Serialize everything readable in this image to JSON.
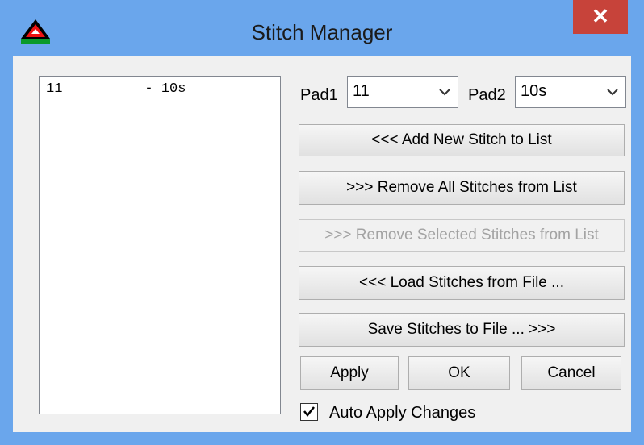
{
  "window": {
    "title": "Stitch Manager",
    "close_label": "✕"
  },
  "stitch_list": {
    "items": [
      "11          - 10s"
    ]
  },
  "pad1": {
    "label": "Pad1",
    "value": "11"
  },
  "pad2": {
    "label": "Pad2",
    "value": "10s"
  },
  "buttons": {
    "add": "<<< Add New Stitch to List",
    "remove_all": ">>> Remove All Stitches from List",
    "remove_selected": ">>> Remove Selected Stitches from List",
    "load": "<<< Load Stitches from File ...",
    "save": "Save Stitches to File ... >>>",
    "apply": "Apply",
    "ok": "OK",
    "cancel": "Cancel"
  },
  "auto_apply": {
    "label": "Auto Apply Changes",
    "checked": true
  },
  "colors": {
    "frame": "#6aa6ec",
    "close": "#c7433a",
    "face": "#f0f0f0"
  }
}
